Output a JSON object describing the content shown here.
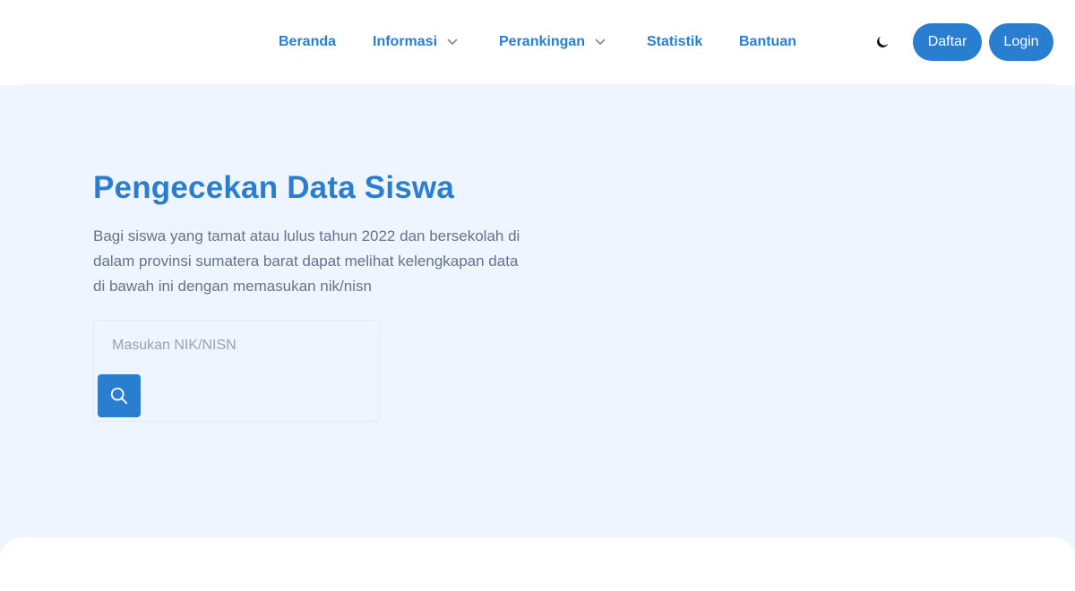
{
  "nav": {
    "items": [
      {
        "label": "Beranda",
        "has_dropdown": false
      },
      {
        "label": "Informasi",
        "has_dropdown": true
      },
      {
        "label": "Perankingan",
        "has_dropdown": true
      },
      {
        "label": "Statistik",
        "has_dropdown": false
      },
      {
        "label": "Bantuan",
        "has_dropdown": false
      }
    ],
    "theme_icon": "moon-icon",
    "register_label": "Daftar",
    "login_label": "Login"
  },
  "hero": {
    "title": "Pengecekan Data Siswa",
    "description": "Bagi siswa yang tamat atau lulus tahun 2022 dan bersekolah di dalam provinsi sumatera barat dapat melihat kelengkapan data di bawah ini dengan memasukan nik/nisn"
  },
  "search": {
    "value": "",
    "placeholder": "Masukan NIK/NISN",
    "icon": "search-icon"
  },
  "colors": {
    "primary": "#2a7ed0",
    "background": "#eef5fe",
    "header": "#ffffff",
    "text_muted": "#64748b"
  }
}
